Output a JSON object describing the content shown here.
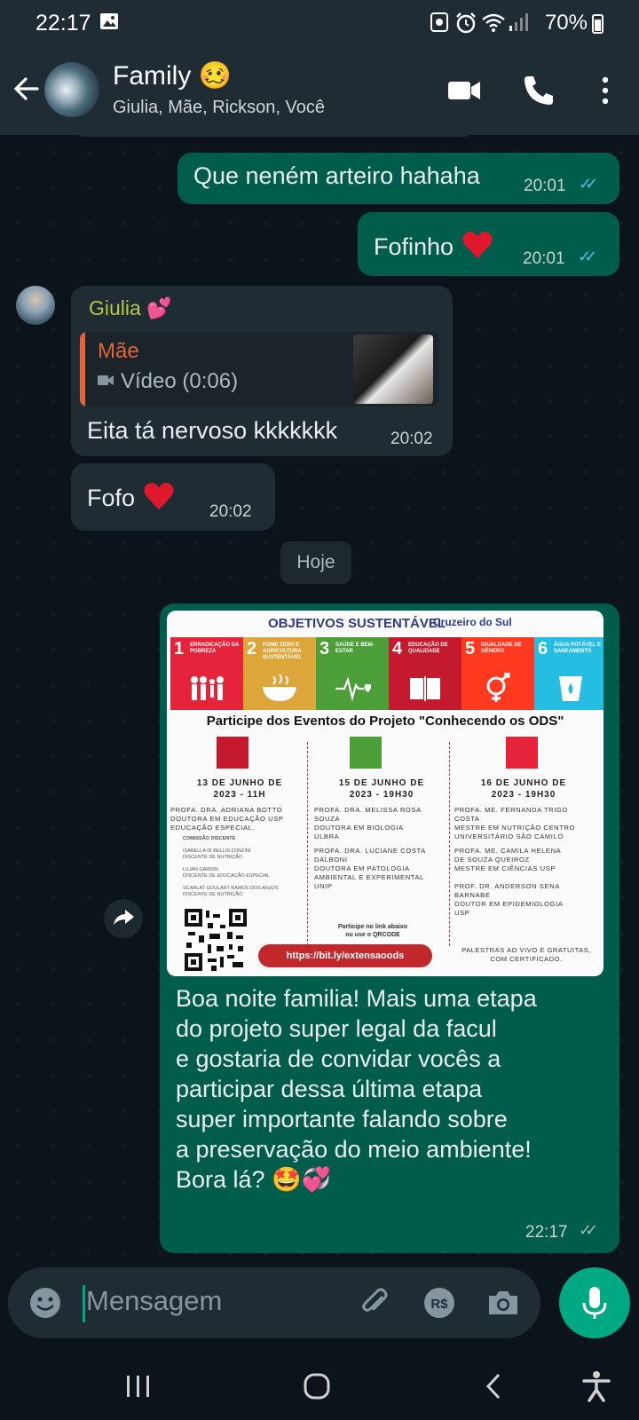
{
  "status_bar": {
    "time": "22:17",
    "battery": "70%"
  },
  "header": {
    "title": "Family 🥴",
    "subtitle": "Giulia, Mãe, Rickson, Você",
    "icons": [
      "back-arrow-icon",
      "video-call-icon",
      "voice-call-icon",
      "more-options-icon"
    ]
  },
  "messages": [
    {
      "dir": "out",
      "text": "Que neném arteiro hahaha",
      "time": "20:01",
      "ticks": "✓✓"
    },
    {
      "dir": "out",
      "text": "Fofinho",
      "time": "20:01",
      "ticks": "✓✓",
      "emoji": "heart"
    },
    {
      "dir": "in",
      "sender": "Giulia 💕",
      "quote_name": "Mãe",
      "quote_text": "Vídeo (0:06)",
      "text": "Eita tá nervoso kkkkkkk",
      "time": "20:02"
    },
    {
      "dir": "in",
      "text": "Fofo",
      "time": "20:02",
      "emoji": "heart"
    }
  ],
  "day_badge": "Hoje",
  "poster": {
    "logo": "OBJETIVOS SUSTENTÁVEL",
    "logo2": "Cruzeiro do Sul",
    "sdgs": [
      {
        "n": "1",
        "label": "ERRADICAÇÃO DA POBREZA",
        "color": "#e5243b"
      },
      {
        "n": "2",
        "label": "FOME ZERO E AGRICULTURA SUSTENTÁVEL",
        "color": "#dda63a"
      },
      {
        "n": "3",
        "label": "SAÚDE E BEM-ESTAR",
        "color": "#4c9f38"
      },
      {
        "n": "4",
        "label": "EDUCAÇÃO DE QUALIDADE",
        "color": "#c5192d"
      },
      {
        "n": "5",
        "label": "IGUALDADE DE GÊNERO",
        "color": "#ff3a21"
      },
      {
        "n": "6",
        "label": "ÁGUA POTÁVEL E SANEAMENTO",
        "color": "#26bde2"
      }
    ],
    "title": "Participe dos Eventos do Projeto \"Conhecendo os ODS\"",
    "events": [
      {
        "date1": "13 DE JUNHO DE",
        "date2": "2023 - 11H",
        "lines": [
          "PROFA. DRA. ADRIANA BOTTO",
          "DOUTORA EM EDUCAÇÃO USP",
          "EDUCAÇÃO ESPECIAL."
        ],
        "small": [
          "COMISSÃO DISCENTE",
          "ISABELLA DI BELLIS ZONZINI",
          "DISCENTE DE NUTRIÇÃO",
          "LILIAN GARDIN",
          "DISCENTE DE EDUCAÇÃO ESPECIAL",
          "SCARLAT GOULART RAMOS DOS ANJOS",
          "DISCENTE DE NUTRIÇÃO"
        ]
      },
      {
        "date1": "15 DE JUNHO DE",
        "date2": "2023 - 19H30",
        "lines": [
          "PROFA. DRA. MELISSA ROSA",
          "SOUZA",
          "DOUTORA EM BIOLOGIA",
          "ULBRA",
          "",
          "PROFA. DRA. LUCIANE COSTA",
          "DALBONI",
          "DOUTORA EM PATOLOGIA",
          "AMBIENTAL E EXPERIMENTAL",
          "UNIP"
        ]
      },
      {
        "date1": "16 DE JUNHO DE",
        "date2": "2023 - 19H30",
        "lines": [
          "PROFA. ME. FERNANDA TRIGO",
          "COSTA",
          "MESTRE EM NUTRIÇÃO CENTRO",
          "UNIVERSITÁRIO SÃO CAMILO",
          "",
          "PROFA. ME. CAMILA HELENA",
          "DE SOUZA QUEIROZ",
          "MESTRE EM CIÊNCIAS USP",
          "",
          "PROF. DR. ANDERSON SENA",
          "BARNABE",
          "DOUTOR EM EPIDEMIOLOGIA",
          "USP"
        ]
      }
    ],
    "cta1": "Participe no link abaixo",
    "cta2": "ou use o QRCODE",
    "link": "https://bit.ly/extensaoods",
    "footer1": "PALESTRAS AO VIVO E GRATUITAS,",
    "footer2": "COM CERTIFICADO."
  },
  "last_message": {
    "lines": [
      "Boa noite familia! Mais uma etapa",
      "do projeto super legal da facul",
      "e gostaria de convidar vocês a",
      "participar dessa última etapa",
      "super importante falando sobre",
      "a preservação do meio ambiente!",
      "Bora lá? 🤩💞"
    ],
    "time": "22:17",
    "ticks": "✓✓"
  },
  "input": {
    "placeholder": "Mensagem"
  },
  "colors": {
    "outgoing": "#005c4b",
    "incoming": "#202c33",
    "accent": "#00a884",
    "read_ticks": "#53bdeb"
  }
}
